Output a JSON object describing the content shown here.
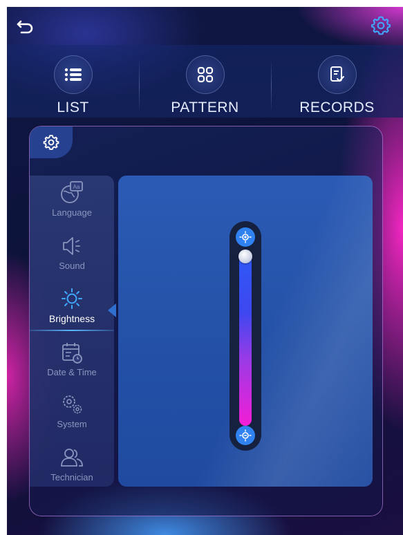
{
  "tabs": [
    {
      "label": "LIST",
      "icon": "list-icon"
    },
    {
      "label": "PATTERN",
      "icon": "grid-icon"
    },
    {
      "label": "RECORDS",
      "icon": "records-icon"
    }
  ],
  "sidebar": {
    "items": [
      {
        "label": "Language",
        "icon": "language-icon"
      },
      {
        "label": "Sound",
        "icon": "speaker-icon"
      },
      {
        "label": "Brightness",
        "icon": "sun-icon",
        "active": true
      },
      {
        "label": "Date & Time",
        "icon": "calendar-icon"
      },
      {
        "label": "System",
        "icon": "gears-icon"
      },
      {
        "label": "Technician",
        "icon": "users-icon"
      }
    ]
  },
  "brightness": {
    "level": 1.0,
    "increase_icon": "brightness-up-icon",
    "decrease_icon": "brightness-down-icon"
  },
  "colors": {
    "accent": "#2f82f0",
    "active_label": "#ffffff",
    "inactive_label": "#8a95bf",
    "slider_top": "#2d59f5",
    "slider_bottom": "#f41ed6"
  }
}
